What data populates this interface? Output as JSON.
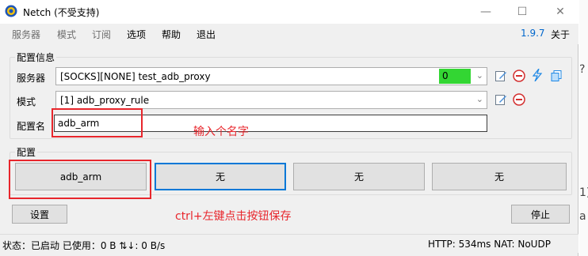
{
  "window": {
    "title": "Netch (不受支持)",
    "controls": {
      "minimize": "—",
      "maximize": "☐",
      "close": "✕"
    }
  },
  "menu": {
    "items": [
      {
        "label": "服务器",
        "enabled": false
      },
      {
        "label": "模式",
        "enabled": false
      },
      {
        "label": "订阅",
        "enabled": false
      },
      {
        "label": "选项",
        "enabled": true
      },
      {
        "label": "帮助",
        "enabled": true
      },
      {
        "label": "退出",
        "enabled": true
      }
    ],
    "version": "1.9.7",
    "about": "关于"
  },
  "config_info": {
    "group_label": "配置信息",
    "server_label": "服务器",
    "server_value": "[SOCKS][NONE] test_adb_proxy",
    "server_delay": "0",
    "mode_label": "模式",
    "mode_value": "[1] adb_proxy_rule",
    "profile_name_label": "配置名",
    "profile_name_value": "adb_arm"
  },
  "annotations": {
    "name_hint": "输入个名字",
    "save_hint": "ctrl+左键点击按钮保存"
  },
  "profiles": {
    "group_label": "配置",
    "buttons": [
      "adb_arm",
      "无",
      "无",
      "无"
    ]
  },
  "actions": {
    "settings": "设置",
    "stop": "停止"
  },
  "status": {
    "left": "状态：已启动  已使用：0 B  ⇅↓: 0 B/s",
    "right": "HTTP: 534ms  NAT: NoUDP"
  },
  "background_fragments": [
    "?",
    "1)",
    "a"
  ],
  "colors": {
    "accent": "#0078d7",
    "delay_ok": "#33d633",
    "annotation": "#e8262c",
    "version_link": "#0066cc"
  }
}
